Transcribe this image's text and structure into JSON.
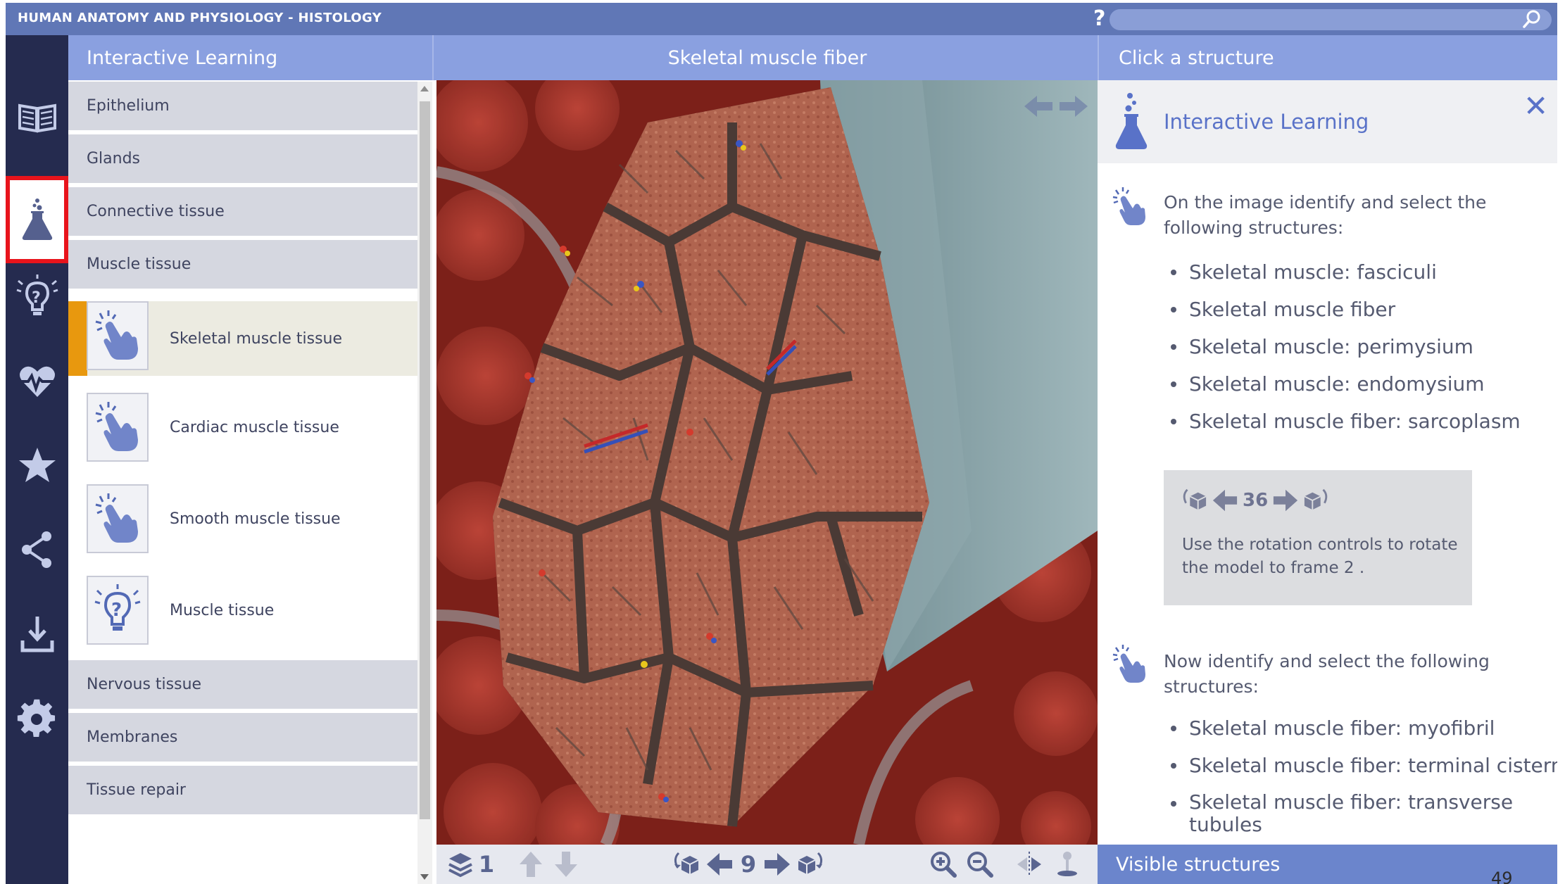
{
  "app": {
    "title": "HUMAN ANATOMY AND PHYSIOLOGY - HISTOLOGY",
    "help_label": "?",
    "search_placeholder": ""
  },
  "rail": {
    "items": [
      {
        "name": "book-icon",
        "active": false
      },
      {
        "name": "az-index-icon",
        "active": false
      },
      {
        "name": "flask-icon",
        "active": true
      },
      {
        "name": "quiz-bulb-icon",
        "active": false
      },
      {
        "name": "heart-pulse-icon",
        "active": false
      },
      {
        "name": "star-icon",
        "active": false
      },
      {
        "name": "share-icon",
        "active": false
      },
      {
        "name": "download-icon",
        "active": false
      },
      {
        "name": "gear-icon",
        "active": false
      }
    ]
  },
  "headers": {
    "left": "Interactive Learning",
    "center": "Skeletal muscle fiber",
    "right": "Click a structure"
  },
  "menu": {
    "categories_top": [
      "Epithelium",
      "Glands",
      "Connective tissue",
      "Muscle tissue"
    ],
    "subitems": [
      {
        "label": "Skeletal muscle tissue",
        "icon": "tap-hand-icon",
        "selected": true
      },
      {
        "label": "Cardiac muscle tissue",
        "icon": "tap-hand-icon",
        "selected": false
      },
      {
        "label": "Smooth muscle tissue",
        "icon": "tap-hand-icon",
        "selected": false
      },
      {
        "label": "Muscle tissue",
        "icon": "quiz-bulb-icon",
        "selected": false
      }
    ],
    "categories_bottom": [
      "Nervous tissue",
      "Membranes",
      "Tissue repair"
    ]
  },
  "toolbar": {
    "layer_count": "1",
    "frame_number": "9"
  },
  "info": {
    "title": "Interactive Learning",
    "close_label": "✕",
    "intro1": "On the image identify and select the following structures:",
    "list1": [
      "Skeletal muscle: fasciculi",
      "Skeletal muscle fiber",
      "Skeletal muscle: perimysium",
      "Skeletal muscle: endomysium",
      "Skeletal muscle fiber: sarcoplasm"
    ],
    "rotation": {
      "frame": "36",
      "text": "Use the rotation controls to rotate the model to frame 2 ."
    },
    "intro2": "Now identify and select the following structures:",
    "list2": [
      "Skeletal muscle fiber: myofibril",
      "Skeletal muscle fiber: terminal cisternae",
      "Skeletal muscle fiber: transverse tubules"
    ]
  },
  "visible_structures_label": "Visible structures",
  "page_number": "49",
  "colors": {
    "title_bar": "#6077b6",
    "header": "#8aa0e0",
    "rail": "#252b4f",
    "accent_orange": "#e8980e",
    "highlight_red": "#e8141c",
    "link_blue": "#5972c8"
  }
}
